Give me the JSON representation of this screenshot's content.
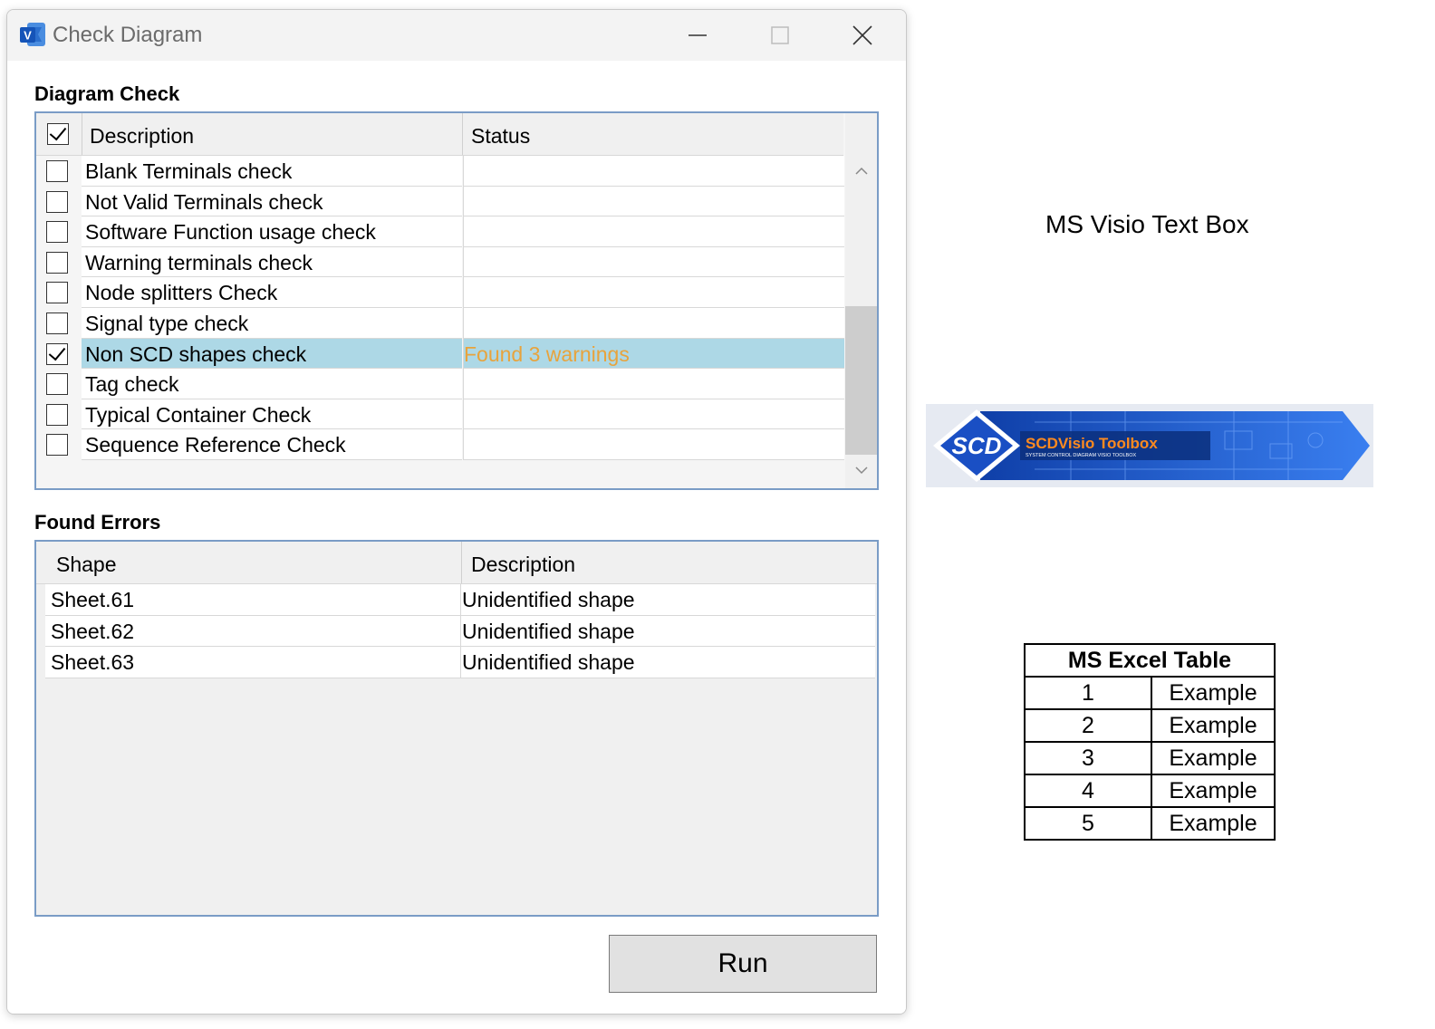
{
  "window": {
    "title": "Check Diagram",
    "app_icon": "visio-icon",
    "controls": [
      "minimize-icon",
      "maximize-icon",
      "close-icon"
    ]
  },
  "diagram_check": {
    "section_title": "Diagram Check",
    "header_checked": true,
    "columns": {
      "description": "Description",
      "status": "Status"
    },
    "rows": [
      {
        "label": "Blank Terminals check",
        "checked": false,
        "status": ""
      },
      {
        "label": "Not Valid Terminals check",
        "checked": false,
        "status": ""
      },
      {
        "label": "Software Function usage check",
        "checked": false,
        "status": ""
      },
      {
        "label": "Warning terminals check",
        "checked": false,
        "status": ""
      },
      {
        "label": "Node splitters Check",
        "checked": false,
        "status": ""
      },
      {
        "label": "Signal type check",
        "checked": false,
        "status": ""
      },
      {
        "label": "Non SCD shapes check",
        "checked": true,
        "status": "Found 3 warnings",
        "selected": true
      },
      {
        "label": "Tag check",
        "checked": false,
        "status": ""
      },
      {
        "label": "Typical Container Check",
        "checked": false,
        "status": ""
      },
      {
        "label": "Sequence Reference Check",
        "checked": false,
        "status": ""
      }
    ]
  },
  "found_errors": {
    "section_title": "Found Errors",
    "columns": {
      "shape": "Shape",
      "description": "Description"
    },
    "rows": [
      {
        "shape": "Sheet.61",
        "description": "Unidentified shape"
      },
      {
        "shape": "Sheet.62",
        "description": "Unidentified shape"
      },
      {
        "shape": "Sheet.63",
        "description": "Unidentified shape"
      }
    ]
  },
  "run_button": {
    "label": "Run"
  },
  "canvas": {
    "text_box": "MS Visio Text Box",
    "banner": {
      "brand": "SCD",
      "title": "SCDVisio Toolbox",
      "subtitle": "SYSTEM CONTROL DIAGRAM VISIO TOOLBOX"
    },
    "excel_table": {
      "header": "MS Excel Table",
      "rows": [
        [
          "1",
          "Example"
        ],
        [
          "2",
          "Example"
        ],
        [
          "3",
          "Example"
        ],
        [
          "4",
          "Example"
        ],
        [
          "5",
          "Example"
        ]
      ]
    }
  },
  "colors": {
    "selection": "#add8e6",
    "warning_text": "#e8a33c",
    "border_blue": "#7a9cc6",
    "banner_blue": "#1f5fd6"
  }
}
